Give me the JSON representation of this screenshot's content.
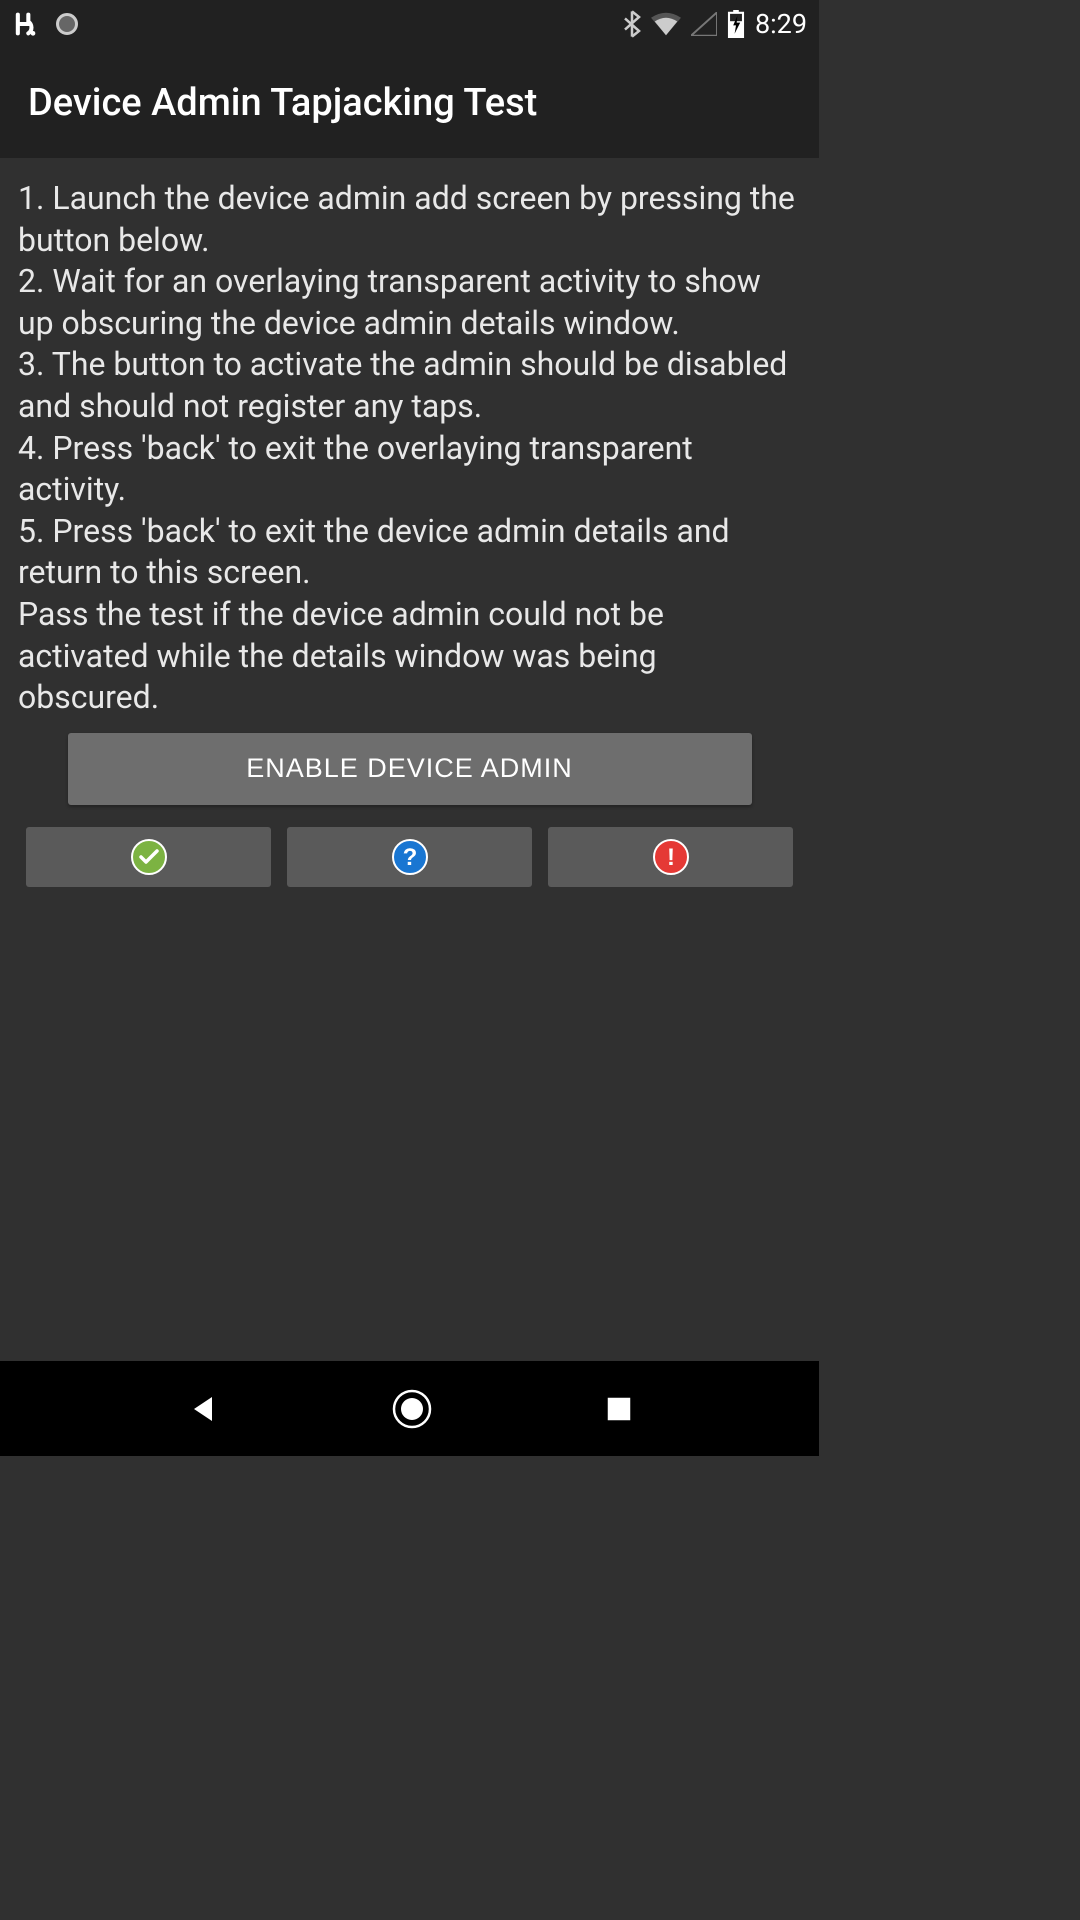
{
  "status_bar": {
    "time": "8:29"
  },
  "app_bar": {
    "title": "Device Admin Tapjacking Test"
  },
  "instructions": "1. Launch the device admin add screen by pressing the button below.\n 2. Wait for an overlaying transparent activity to show up obscuring the device admin details window.\n 3. The button to activate the admin should be disabled and should not register any taps.\n 4. Press 'back' to exit the overlaying transparent activity.\n 5. Press 'back' to exit the device admin details and return to this screen.\n Pass the test if the device admin could not be activated while the details window was being obscured.",
  "buttons": {
    "enable_label": "ENABLE DEVICE ADMIN"
  }
}
